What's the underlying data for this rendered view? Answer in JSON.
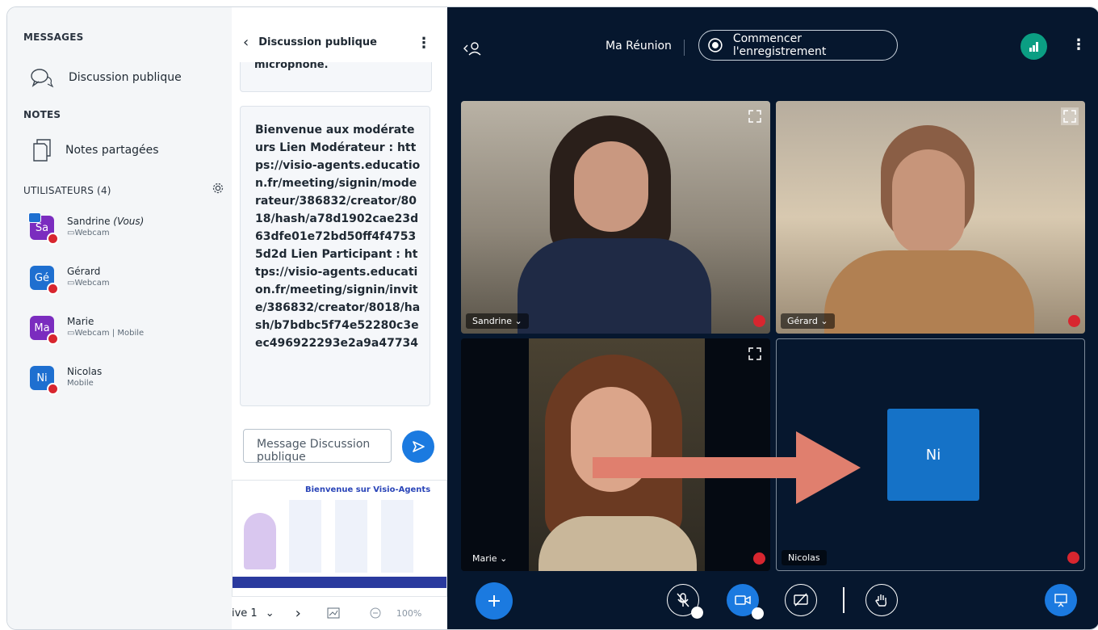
{
  "sidebar": {
    "messages_title": "MESSAGES",
    "public_chat": "Discussion publique",
    "notes_title": "NOTES",
    "shared_notes": "Notes partagées",
    "users_title": "UTILISATEURS (4)",
    "users": [
      {
        "initials": "Sa",
        "name": "Sandrine",
        "you": "(Vous)",
        "sub": "Webcam",
        "color": "#7b2cbf"
      },
      {
        "initials": "Gé",
        "name": "Gérard",
        "sub": "Webcam",
        "color": "#1e6fd0"
      },
      {
        "initials": "Ma",
        "name": "Marie",
        "sub": "Webcam | Mobile",
        "color": "#7b2cbf"
      },
      {
        "initials": "Ni",
        "name": "Nicolas",
        "sub": "Mobile",
        "color": "#1e6fd0"
      }
    ]
  },
  "chat": {
    "title": "Discussion publique",
    "prev_message_tail": "microphone.",
    "message": "Bienvenue aux modérateurs Lien Modérateur : https://visio-agents.education.fr/meeting/signin/moderateur/386832/creator/8018/hash/a78d1902cae23d63dfe01e72bd50ff4f47535d2d Lien Participant : https://visio-agents.education.fr/meeting/signin/invite/386832/creator/8018/hash/b7bdbc5f74e52280c3eec496922293e2a9a47734",
    "input_placeholder": "Message Discussion publique"
  },
  "presentation": {
    "slide_title": "Bienvenue sur Visio-Agents",
    "slide_label": "ive 1",
    "zoom": "100%"
  },
  "meeting": {
    "title": "Ma Réunion",
    "record_label": "Commencer l'enregistrement",
    "tiles": [
      {
        "name": "Sandrine",
        "has_dropdown": true
      },
      {
        "name": "Gérard",
        "has_dropdown": true
      },
      {
        "name": "Marie",
        "has_dropdown": true
      },
      {
        "name": "Nicolas",
        "initials": "Ni"
      }
    ]
  },
  "colors": {
    "accent": "#1b7ae0",
    "meeting_bg": "#06172e",
    "muted_red": "#d8262f",
    "annotation_arrow": "#e07f6e"
  }
}
